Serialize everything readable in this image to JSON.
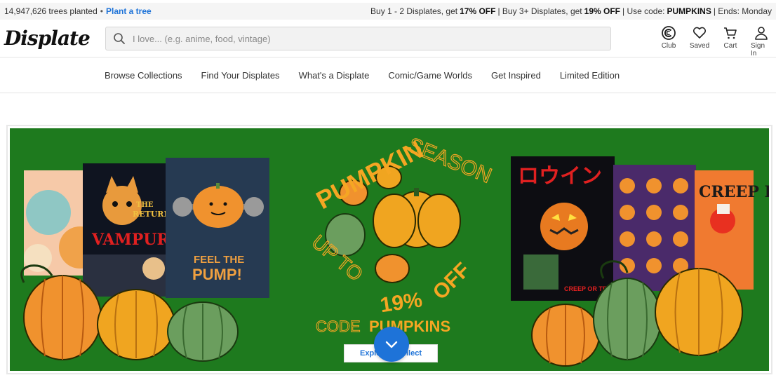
{
  "topbar": {
    "trees_text": "14,947,626 trees planted",
    "bullet": "•",
    "plant_link": "Plant a tree",
    "promo_part1": "Buy 1 - 2 Displates, get",
    "promo_off1": "17% OFF",
    "promo_sep1": "| Buy 3+ Displates, get",
    "promo_off2": "19% OFF",
    "promo_sep2": "| Use code:",
    "promo_code": "PUMPKINS",
    "promo_ends": "| Ends: Monday"
  },
  "header": {
    "logo_text": "Displate",
    "search_placeholder": "I love... (e.g. anime, food, vintage)",
    "icons": [
      {
        "name": "club-icon",
        "label": "Club"
      },
      {
        "name": "heart-icon",
        "label": "Saved"
      },
      {
        "name": "cart-icon",
        "label": "Cart"
      },
      {
        "name": "user-icon",
        "label": "Sign In"
      }
    ]
  },
  "nav": {
    "items": [
      "Browse Collections",
      "Find Your Displates",
      "What's a Displate",
      "Comic/Game Worlds",
      "Get Inspired",
      "Limited Edition"
    ]
  },
  "banner": {
    "headline_1": "PUMPKIN",
    "headline_2": "SEASON",
    "headline_3": "UP TO",
    "headline_4": "19%",
    "headline_5": "OFF",
    "code_label": "CODE",
    "code_value": "PUMPKINS",
    "poster_1": "THE RETURN OF VAMPURR",
    "poster_2": "FEEL THE PUMP!",
    "poster_3": "ロウイン",
    "poster_3_sub": "CREEP OR TREAT!!",
    "poster_4": "CREEP REAL",
    "explore_left": "Explo",
    "explore_right": "ollect",
    "colors": {
      "bg": "#1e7a1e",
      "accent": "#f5a623",
      "pumpkin": "#f0a020",
      "green_pumpkin": "#6b9e5e"
    }
  }
}
